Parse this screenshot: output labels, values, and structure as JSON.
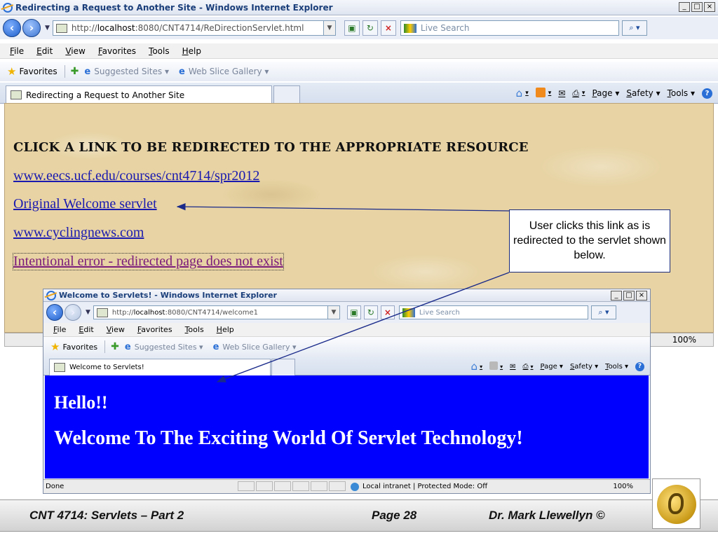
{
  "outer": {
    "window_title": "Redirecting a Request to Another Site - Windows Internet Explorer",
    "url_prefix": "http://",
    "url_host": "localhost",
    "url_rest": ":8080/CNT4714/ReDirectionServlet.html",
    "search_placeholder": "Live Search",
    "tab_title": "Redirecting a Request to Another Site",
    "status_zoom": "100%",
    "heading": "CLICK A LINK TO BE REDIRECTED TO THE APPROPRIATE RESOURCE",
    "links": [
      "www.eecs.ucf.edu/courses/cnt4714/spr2012",
      "Original Welcome servlet",
      "www.cyclingnews.com",
      "Intentional error - redirected page does not exist"
    ]
  },
  "menu": [
    "File",
    "Edit",
    "View",
    "Favorites",
    "Tools",
    "Help"
  ],
  "favorites": {
    "label": "Favorites",
    "suggested": "Suggested Sites ▾",
    "webslice": "Web Slice Gallery ▾"
  },
  "commands": {
    "page": "Page ▾",
    "safety": "Safety ▾",
    "tools": "Tools ▾"
  },
  "callout": "User clicks this link as is redirected to the servlet shown below.",
  "inner": {
    "window_title": "Welcome to Servlets! - Windows Internet Explorer",
    "url_prefix": "http://",
    "url_host": "localhost",
    "url_rest": ":8080/CNT4714/welcome1",
    "search_placeholder": "Live Search",
    "tab_title": "Welcome to Servlets!",
    "hello": "Hello!!",
    "welcome": "Welcome To The Exciting World Of Servlet Technology!",
    "status_done": "Done",
    "status_zone": "Local intranet | Protected Mode: Off",
    "status_zoom": "100%"
  },
  "footer": {
    "left": "CNT 4714: Servlets – Part 2",
    "center": "Page 28",
    "right": "Dr. Mark Llewellyn ©"
  },
  "colors": {
    "inner_background": "#0000ff",
    "outer_background": "#e7d3a3",
    "link": "#1a1ab0"
  }
}
